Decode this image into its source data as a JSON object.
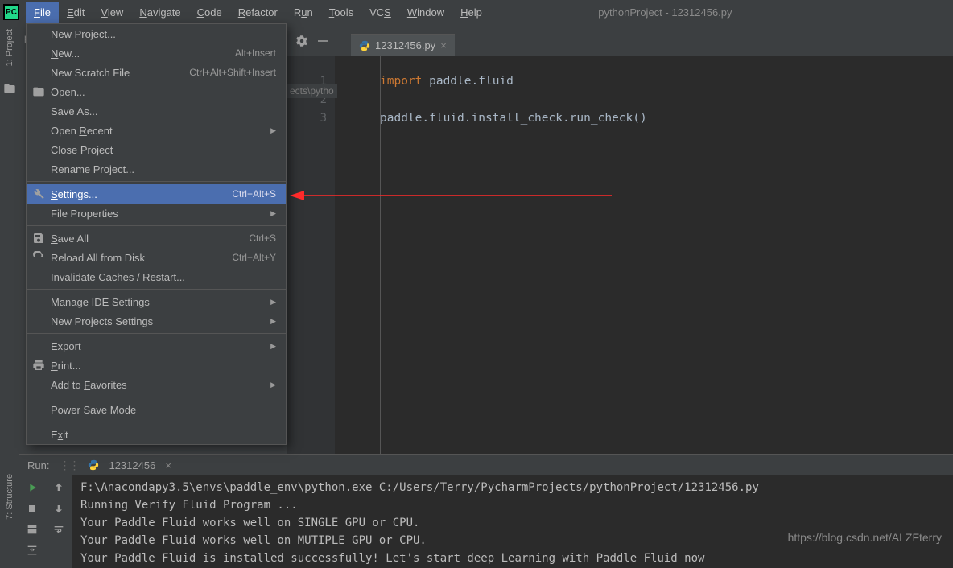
{
  "title": "pythonProject - 12312456.py",
  "menubar": [
    "File",
    "Edit",
    "View",
    "Navigate",
    "Code",
    "Refactor",
    "Run",
    "Tools",
    "VCS",
    "Window",
    "Help"
  ],
  "menubar_ul": [
    "F",
    "E",
    "V",
    "N",
    "C",
    "R",
    "u",
    "T",
    "S",
    "W",
    "H"
  ],
  "proj_stub": "py",
  "dropdown": {
    "items": [
      {
        "label": "New Project..."
      },
      {
        "label": "New...",
        "ul": "N",
        "shortcut": "Alt+Insert"
      },
      {
        "label": "New Scratch File",
        "shortcut": "Ctrl+Alt+Shift+Insert"
      },
      {
        "label": "Open...",
        "ul": "O",
        "icon": "folder"
      },
      {
        "label": "Save As..."
      },
      {
        "label": "Open Recent",
        "ul": "R",
        "sub": true
      },
      {
        "label": "Close Project"
      },
      {
        "label": "Rename Project..."
      },
      {
        "sep": true
      },
      {
        "label": "Settings...",
        "ul": "S",
        "shortcut": "Ctrl+Alt+S",
        "icon": "wrench",
        "selected": true
      },
      {
        "label": "File Properties",
        "sub": true
      },
      {
        "sep": true
      },
      {
        "label": "Save All",
        "ul": "S",
        "shortcut": "Ctrl+S",
        "icon": "save"
      },
      {
        "label": "Reload All from Disk",
        "shortcut": "Ctrl+Alt+Y",
        "icon": "reload"
      },
      {
        "label": "Invalidate Caches / Restart..."
      },
      {
        "sep": true
      },
      {
        "label": "Manage IDE Settings",
        "sub": true
      },
      {
        "label": "New Projects Settings",
        "sub": true
      },
      {
        "sep": true
      },
      {
        "label": "Export",
        "sub": true
      },
      {
        "label": "Print...",
        "ul": "P",
        "icon": "print"
      },
      {
        "label": "Add to Favorites",
        "ul": "F",
        "sub": true
      },
      {
        "sep": true
      },
      {
        "label": "Power Save Mode"
      },
      {
        "sep": true
      },
      {
        "label": "Exit",
        "ul": "x"
      }
    ]
  },
  "breadcrumb": "ects\\pytho",
  "editor": {
    "tab": "12312456.py",
    "lines": [
      "1",
      "2",
      "3"
    ],
    "code": {
      "l1_kw": "import",
      "l1_rest": " paddle.fluid",
      "l3": "paddle.fluid.install_check.run_check()"
    }
  },
  "run": {
    "label": "Run:",
    "config": "12312456",
    "output": [
      "F:\\Anacondapy3.5\\envs\\paddle_env\\python.exe C:/Users/Terry/PycharmProjects/pythonProject/12312456.py",
      "Running Verify Fluid Program ... ",
      "Your Paddle Fluid works well on SINGLE GPU or CPU.",
      "Your Paddle Fluid works well on MUTIPLE GPU or CPU.",
      "Your Paddle Fluid is installed successfully! Let's start deep Learning with Paddle Fluid now"
    ]
  },
  "left_tools": {
    "project": "1: Project",
    "structure": "7: Structure"
  },
  "watermark": "https://blog.csdn.net/ALZFterry"
}
